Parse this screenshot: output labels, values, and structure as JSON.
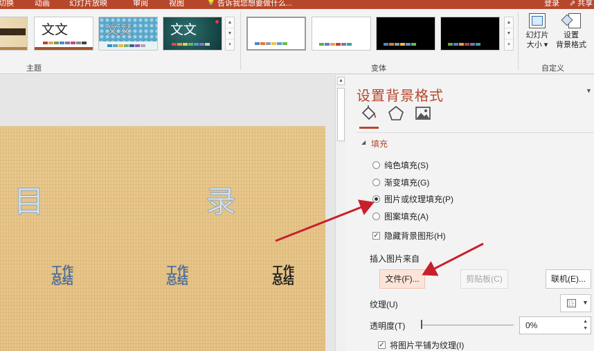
{
  "colors": {
    "accent": "#b7472a",
    "arrow": "#c8202a",
    "slide_text": "#4f6f9a"
  },
  "titlebar": {
    "tabs": [
      "切换",
      "动画",
      "幻灯片放映",
      "审阅",
      "视图"
    ],
    "tell_me": "告诉我您想要做什么...",
    "sign_in": "登录",
    "share": "共享"
  },
  "ribbon": {
    "themes": {
      "label": "主题",
      "thumb_text": "文文",
      "items": [
        "theme-wood",
        "theme-white",
        "theme-pattern",
        "theme-teal"
      ]
    },
    "variants": {
      "label": "变体",
      "items": [
        "variant-white-1",
        "variant-white-2",
        "variant-black-1",
        "variant-black-2"
      ]
    },
    "customize": {
      "label": "自定义",
      "slide_size_line1": "幻灯片",
      "slide_size_line2": "大小",
      "format_bg_line1": "设置",
      "format_bg_line2": "背景格式"
    }
  },
  "slide": {
    "title_chars": [
      "目",
      "录"
    ],
    "items": [
      {
        "line1": "工作",
        "line2": "总结"
      },
      {
        "line1": "工作",
        "line2": "总结"
      },
      {
        "line1": "工作",
        "line2": "总结"
      }
    ]
  },
  "panel": {
    "title": "设置背景格式",
    "tab_icons": [
      "fill-icon",
      "effects-pentagon-icon",
      "picture-icon"
    ],
    "section": "填充",
    "fill_options": [
      {
        "label": "纯色填充(S)",
        "selected": false
      },
      {
        "label": "渐变填充(G)",
        "selected": false
      },
      {
        "label": "图片或纹理填充(P)",
        "selected": true
      },
      {
        "label": "图案填充(A)",
        "selected": false
      }
    ],
    "hide_bg_graphics": {
      "label": "隐藏背景图形(H)",
      "checked": true
    },
    "insert_from_label": "插入图片来自",
    "file_btn": "文件(F)...",
    "clipboard_btn": "剪贴板(C)",
    "online_btn": "联机(E)...",
    "texture_label": "纹理(U)",
    "transparency_label": "透明度(T)",
    "transparency_value": "0%",
    "tile_checkbox": {
      "label": "将图片平铺为纹理(I)",
      "checked": true
    }
  }
}
